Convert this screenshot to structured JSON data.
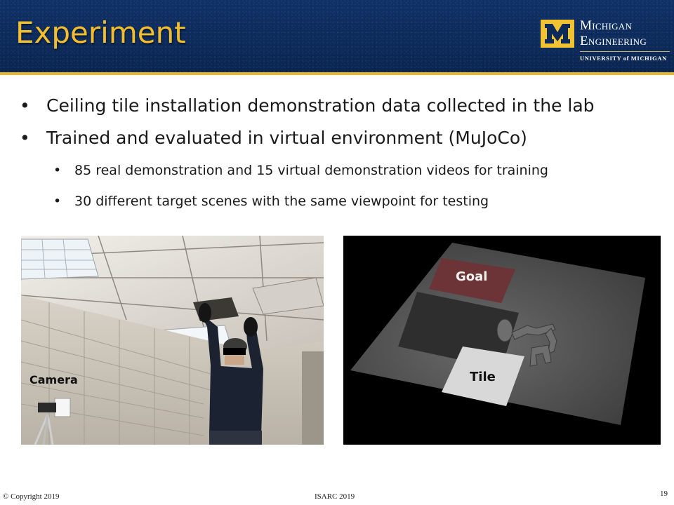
{
  "slide": {
    "title": "Experiment",
    "logo": {
      "line1": "Michigan",
      "line2": "Engineering",
      "subline": "UNIVERSITY of MICHIGAN"
    },
    "bullets": [
      "Ceiling tile installation demonstration data collected in the lab",
      "Trained and evaluated in virtual environment (MuJoCo)"
    ],
    "sub_bullets": [
      "85 real demonstration and 15 virtual demonstration videos for training",
      "30 different target scenes with the same viewpoint for testing"
    ],
    "photo_label": "Camera",
    "sim_labels": {
      "goal": "Goal",
      "tile": "Tile"
    }
  },
  "footer": {
    "copyright": "© Copyright 2019",
    "conference": "ISARC 2019",
    "page_number": "19"
  },
  "colors": {
    "header_bg": "#0c2a5a",
    "title_gold": "#f3be2e",
    "rule_gold": "#e8b631",
    "goal_red": "#7a3436"
  }
}
